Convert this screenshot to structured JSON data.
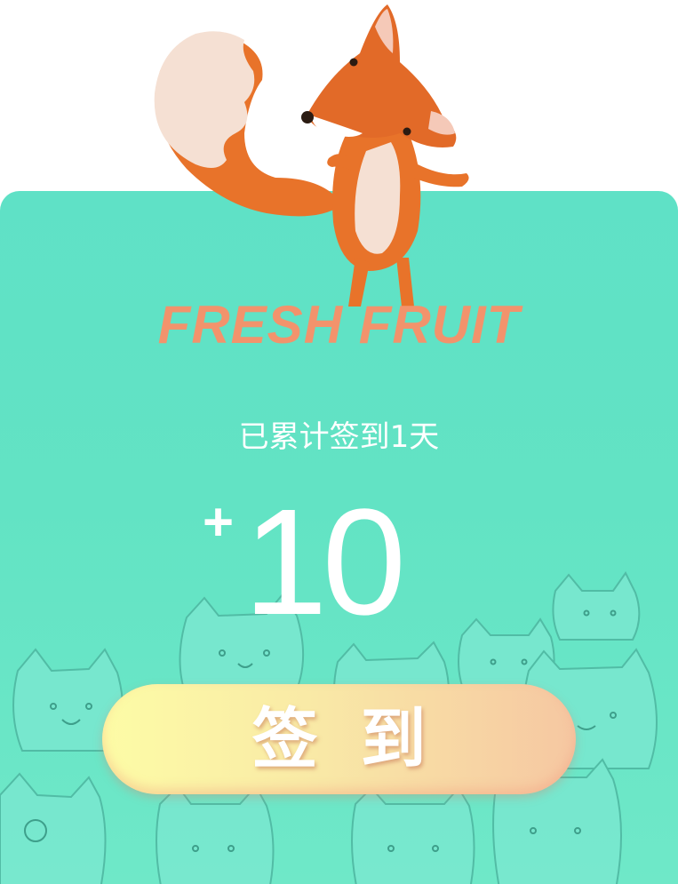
{
  "slogan": "FRESH FRUIT",
  "status_text": "已累计签到1天",
  "points": {
    "prefix": "+",
    "value": "10"
  },
  "checkin_button_label": "签到",
  "colors": {
    "card_background": "#5fe1c6",
    "slogan": "#f2936c",
    "fox_orange": "#e8732a",
    "button_start": "#fdfca6",
    "button_end": "#f6c7a2"
  },
  "icons": {
    "mascot": "fox-icon",
    "background": "cat-doodles"
  }
}
